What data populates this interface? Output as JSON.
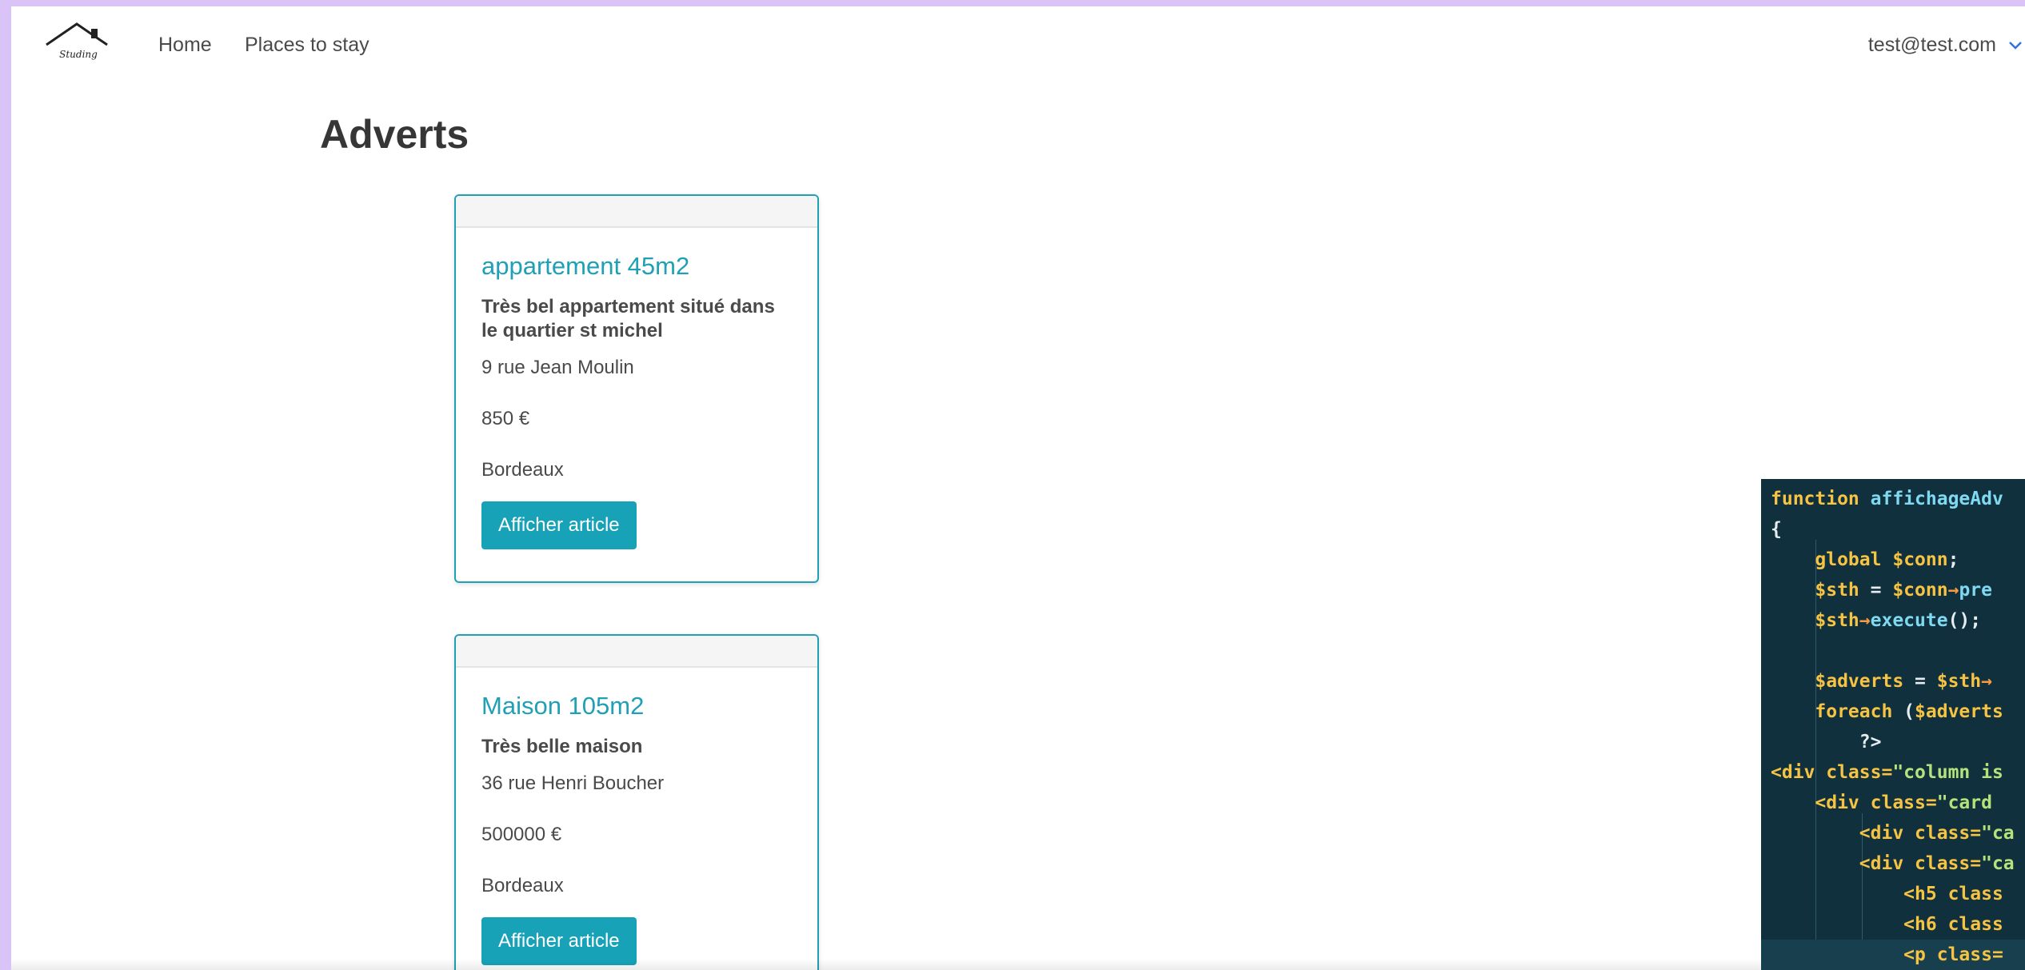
{
  "navbar": {
    "logo_text": "Studing",
    "links": [
      {
        "label": "Home"
      },
      {
        "label": "Places to stay"
      }
    ],
    "user_email": "test@test.com"
  },
  "page": {
    "title": "Adverts"
  },
  "adverts": [
    {
      "title": "appartement 45m2",
      "description": "Très bel appartement situé dans le quartier st michel",
      "address": "9 rue Jean Moulin",
      "price": "850 €",
      "city": "Bordeaux",
      "button_label": "Afficher article"
    },
    {
      "title": "Maison 105m2",
      "description": "Très belle maison",
      "address": "36 rue Henri Boucher",
      "price": "500000 €",
      "city": "Bordeaux",
      "button_label": "Afficher article"
    }
  ],
  "code": {
    "l1_kw": "function",
    "l1_fn": "affichageAdv",
    "l2": "{",
    "l3_kw": "global",
    "l3_var": "$conn",
    "l3_end": ";",
    "l4_var1": "$sth",
    "l4_eq": " = ",
    "l4_var2": "$conn",
    "l4_arrow": "→",
    "l4_fn": "pre",
    "l5_var": "$sth",
    "l5_arrow": "→",
    "l5_fn": "execute",
    "l5_end": "();",
    "l6_var1": "$adverts",
    "l6_eq": " = ",
    "l6_var2": "$sth",
    "l6_arrow": "→",
    "l7_kw": "foreach",
    "l7_paren": " (",
    "l7_var": "$adverts",
    "l8": "?>",
    "l9_tag": "<div",
    "l9_attr": " class=",
    "l9_str": "\"column is",
    "l10_tag": "<div",
    "l10_attr": " class=",
    "l10_str": "\"card",
    "l11_tag": "<div",
    "l11_attr": " class=",
    "l11_str": "\"ca",
    "l12_tag": "<div",
    "l12_attr": " class=",
    "l12_str": "\"ca",
    "l13_tag": "<h5",
    "l13_attr": " class",
    "l14_tag": "<h6",
    "l14_attr": " class",
    "l15_tag": "<p",
    "l15_attr": " class="
  },
  "colors": {
    "accent": "#1fa0b5",
    "button": "#17a2b8",
    "background_frame": "#d9c3f7",
    "code_bg": "#10303d"
  }
}
